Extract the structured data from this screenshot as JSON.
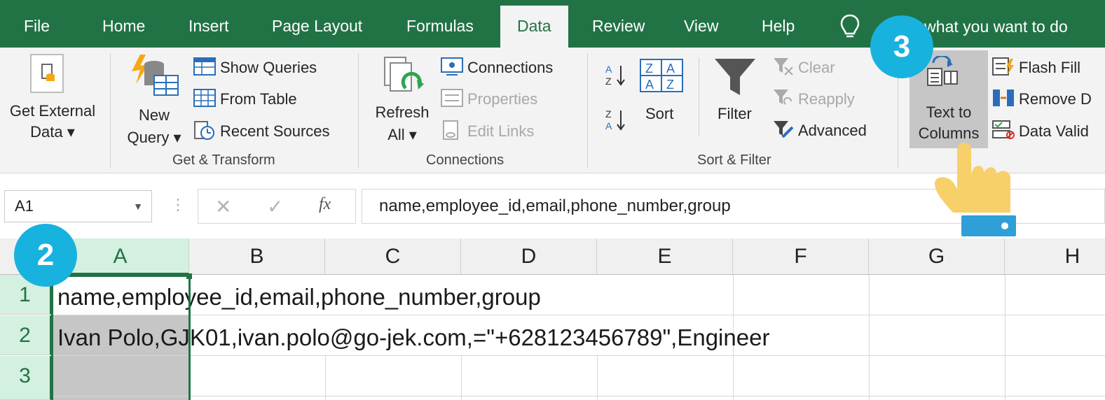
{
  "tabs": [
    {
      "label": "File",
      "active": false
    },
    {
      "label": "Home",
      "active": false
    },
    {
      "label": "Insert",
      "active": false
    },
    {
      "label": "Page Layout",
      "active": false
    },
    {
      "label": "Formulas",
      "active": false
    },
    {
      "label": "Data",
      "active": true
    },
    {
      "label": "Review",
      "active": false
    },
    {
      "label": "View",
      "active": false
    },
    {
      "label": "Help",
      "active": false
    }
  ],
  "tell_me": {
    "text": "e what you want to do",
    "icon": "lightbulb-icon"
  },
  "ribbon": {
    "get_external": {
      "line1": "Get External",
      "line2": "Data ▾"
    },
    "new_query": {
      "line1": "New",
      "line2": "Query ▾"
    },
    "show_queries": "Show Queries",
    "from_table": "From Table",
    "recent_sources": "Recent Sources",
    "get_transform_label": "Get & Transform",
    "refresh_all": {
      "line1": "Refresh",
      "line2": "All ▾"
    },
    "connections": "Connections",
    "properties": "Properties",
    "edit_links": "Edit Links",
    "connections_label": "Connections",
    "sort": "Sort",
    "filter": "Filter",
    "clear": "Clear",
    "reapply": "Reapply",
    "advanced": "Advanced",
    "sort_filter_label": "Sort & Filter",
    "text_to_columns": {
      "line1": "Text to",
      "line2": "Columns"
    },
    "flash_fill": "Flash Fill",
    "remove_duplicates": "Remove D",
    "data_validation": "Data Valid"
  },
  "formula_bar": {
    "name_box": "A1",
    "fx": "fx",
    "formula": "name,employee_id,email,phone_number,group"
  },
  "columns": [
    "A",
    "B",
    "C",
    "D",
    "E",
    "F",
    "G",
    "H"
  ],
  "selected_column": "A",
  "rows": [
    {
      "num": "1",
      "text": "name,employee_id,email,phone_number,group"
    },
    {
      "num": "2",
      "text": "Ivan Polo,GJK01,ivan.polo@go-jek.com,=\"+628123456789\",Engineer"
    },
    {
      "num": "3",
      "text": ""
    }
  ],
  "callouts": {
    "step2": "2",
    "step3": "3"
  },
  "colors": {
    "excel_green": "#217346",
    "badge_blue": "#18b2df",
    "selection_fill": "#c6c6c6",
    "hand_yellow": "#f8d06a",
    "cuff_blue": "#2f9fd8"
  }
}
